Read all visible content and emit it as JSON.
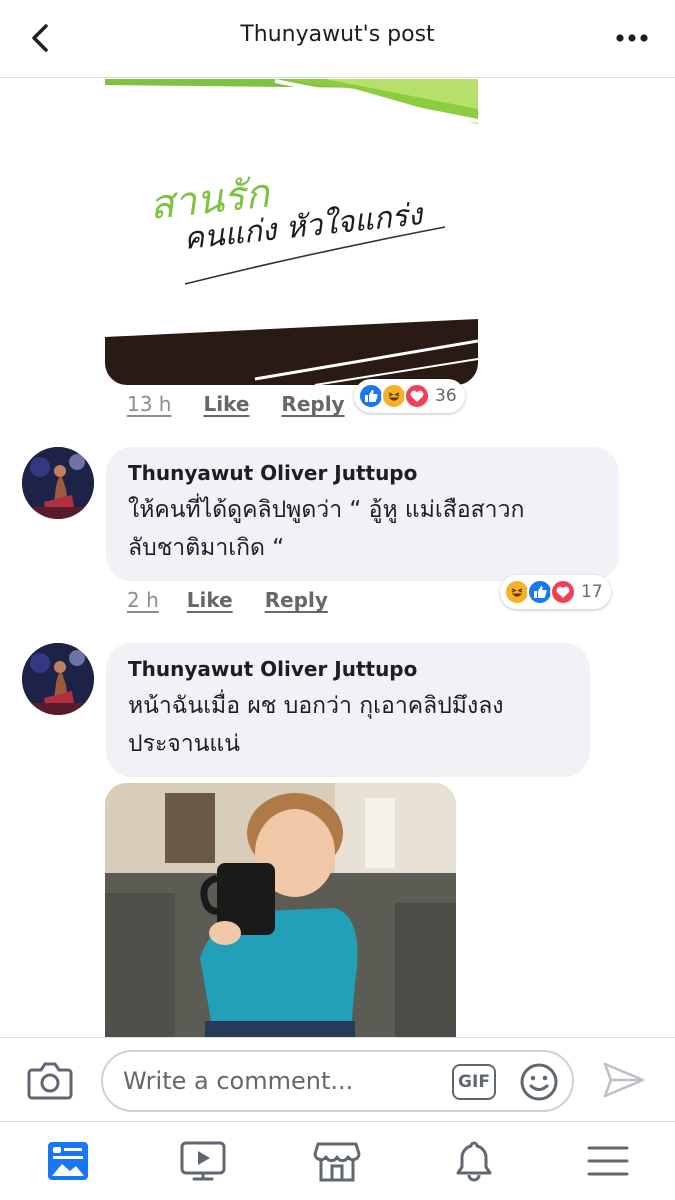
{
  "header": {
    "title": "Thunyawut's post",
    "back_icon": "chevron-left-icon",
    "more_icon": "more-dots-icon"
  },
  "comments": [
    {
      "type": "sticker",
      "sticker_text_line1": "สานรัก",
      "sticker_text_line2": "คนแก่ง หัวใจแกร่ง",
      "time": "13 h",
      "like": "Like",
      "reply": "Reply",
      "reactions": [
        "like",
        "haha",
        "love"
      ],
      "reaction_count": "36"
    },
    {
      "author": "Thunyawut Oliver Juttupo",
      "line1": "ให้คนที่ได้ดูคลิปพูดว่า “ อู้หู แม่เสือสาวก",
      "line2": "ลับชาติมาเกิด “",
      "time": "2 h",
      "like": "Like",
      "reply": "Reply",
      "reactions": [
        "haha",
        "like",
        "love"
      ],
      "reaction_count": "17"
    },
    {
      "author": "Thunyawut Oliver Juttupo",
      "line1": "หน้าฉันเมื่อ ผช บอกว่า กุเอาคลิปมึงลง",
      "line2": "ประจานแน่",
      "attachment": "photo of a child drinking from a black mug"
    }
  ],
  "composer": {
    "placeholder": "Write a comment...",
    "gif_label": "GIF",
    "camera_icon": "camera-icon",
    "emoji_icon": "smiley-icon",
    "send_icon": "send-icon"
  },
  "tabbar": [
    "news-feed-icon",
    "watch-icon",
    "marketplace-icon",
    "notifications-icon",
    "menu-icon"
  ],
  "colors": {
    "accent": "#1877f2",
    "love": "#f33e58",
    "haha": "#f7b125",
    "bubble": "#f0f2f5",
    "sticker_green": "#7dc241"
  }
}
